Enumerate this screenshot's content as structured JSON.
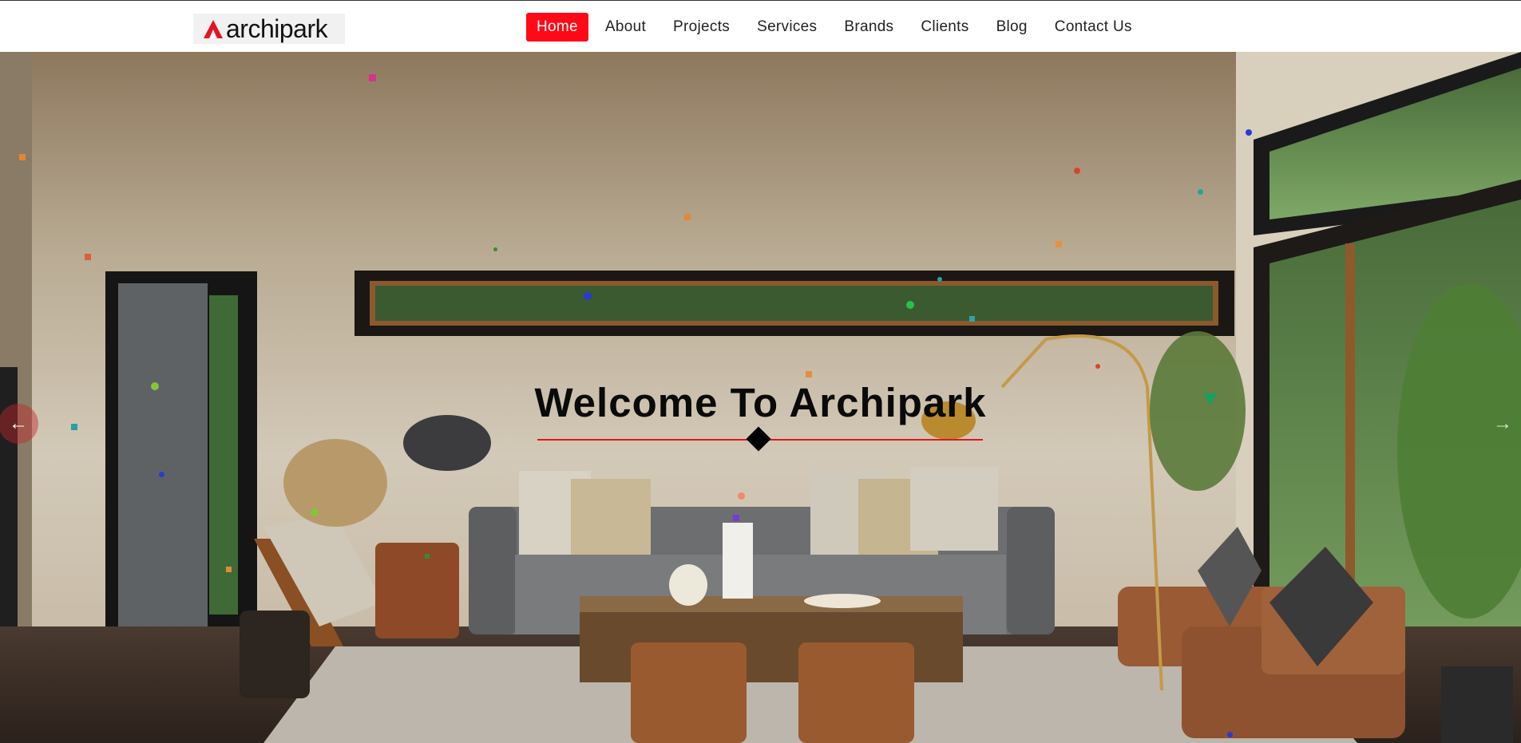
{
  "header": {
    "logo_text": "archipark",
    "nav": [
      {
        "label": "Home",
        "active": true
      },
      {
        "label": "About"
      },
      {
        "label": "Projects"
      },
      {
        "label": "Services"
      },
      {
        "label": "Brands"
      },
      {
        "label": "Clients"
      },
      {
        "label": "Blog"
      },
      {
        "label": "Contact Us"
      }
    ]
  },
  "hero": {
    "title": "Welcome To Archipark",
    "prev_arrow": "←",
    "next_arrow": "→"
  },
  "colors": {
    "accent": "#ff0a16",
    "divider": "#e3151f",
    "title": "#0a0a0a"
  }
}
